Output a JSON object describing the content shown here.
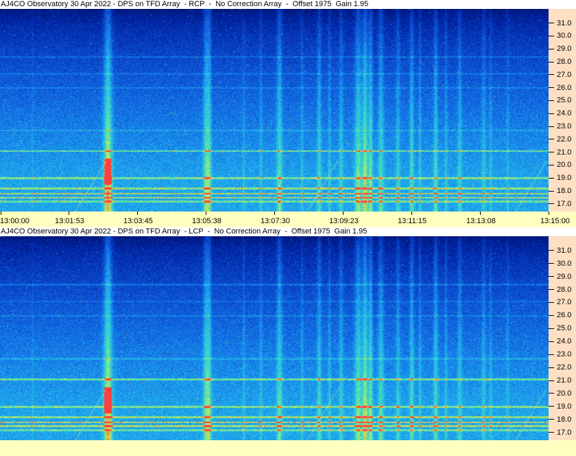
{
  "panels": [
    {
      "title": "AJ4CO Observatory 30 Apr 2022 - DPS on TFD Array  - RCP  -  No Correction Array  -  Offset 1975  Gain 1.95",
      "polarization": "RCP"
    },
    {
      "title": "AJ4CO Observatory 30 Apr 2022 - DPS on TFD Array  - LCP  -  No Correction Array  -  Offset 1975  Gain 1.95",
      "polarization": "LCP"
    }
  ],
  "chart_data": {
    "type": "heatmap",
    "x_tick_labels": [
      "13:00:00",
      "13:01:53",
      "13:03:45",
      "13:05:38",
      "13:07:30",
      "13:09:23",
      "13:11:15",
      "13:13:08",
      "13:15:00"
    ],
    "y_tick_labels": [
      "31.0",
      "30.0",
      "29.0",
      "28.0",
      "27.0",
      "26.0",
      "25.0",
      "24.0",
      "23.0",
      "22.0",
      "21.0",
      "20.0",
      "19.0",
      "18.0",
      "17.0"
    ],
    "ylim": [
      16.4,
      32.1
    ],
    "xlim": [
      "13:00:00",
      "13:15:00"
    ],
    "y_axis_position": "right",
    "colormap": [
      "#000010",
      "#0020a0",
      "#1060e0",
      "#20b0f0",
      "#40e0c0",
      "#e0f040",
      "#ff4040"
    ]
  }
}
